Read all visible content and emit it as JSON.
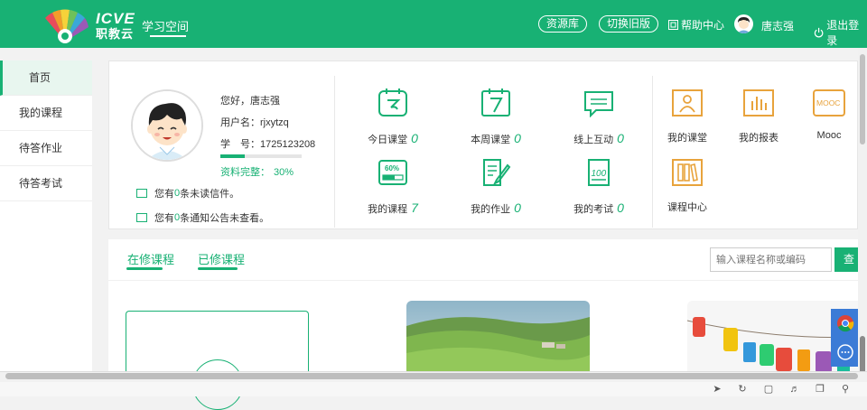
{
  "header": {
    "logo_en": "ICVE",
    "logo_cn": "职教云",
    "subtitle": "学习空间",
    "resource_btn": "资源库",
    "switch_btn": "切换旧版",
    "help": "帮助中心",
    "username": "唐志强",
    "logout": "退出登录"
  },
  "sidebar": {
    "items": [
      {
        "label": "首页",
        "active": true
      },
      {
        "label": "我的课程"
      },
      {
        "label": "待答作业"
      },
      {
        "label": "待答考试"
      }
    ]
  },
  "profile": {
    "greeting": "您好，唐志强",
    "username_line": "用户名：rjxytzq",
    "student_id_line": "学　号：1725123208",
    "completeness_label": "资料完整：",
    "completeness_value": "30%",
    "completeness": 0.3,
    "mail_pre": "您有",
    "mail_count": "0",
    "mail_post": "条未读信件。",
    "notice_pre": "您有",
    "notice_count": "0",
    "notice_post": "条通知公告未查看。"
  },
  "stats": [
    {
      "label": "今日课堂",
      "value": "0",
      "icon": "clock-bubble-icon"
    },
    {
      "label": "本周课堂",
      "value": "0",
      "icon": "calendar-7-icon"
    },
    {
      "label": "线上互动",
      "value": "0",
      "icon": "chat-icon"
    },
    {
      "label": "我的课程",
      "value": "7",
      "icon": "progress-60-icon",
      "icon_text": "60%"
    },
    {
      "label": "我的作业",
      "value": "0",
      "icon": "edit-doc-icon"
    },
    {
      "label": "我的考试",
      "value": "0",
      "icon": "exam-100-icon",
      "icon_text": "100"
    }
  ],
  "entries": [
    {
      "label": "我的课堂",
      "icon": "teacher-icon"
    },
    {
      "label": "我的报表",
      "icon": "bar-report-icon"
    },
    {
      "label": "Mooc",
      "icon": "mooc-icon",
      "icon_text": "MOOC"
    },
    {
      "label": "课程中心",
      "icon": "books-icon"
    }
  ],
  "courses": {
    "tab_active": "在修课程",
    "tab_done": "已修课程",
    "search_placeholder": "输入课程名称或编码",
    "search_btn": "查询"
  },
  "colors": {
    "brand": "#18b174",
    "entry_orange": "#e8a33c",
    "float_blue": "#3b7bd6"
  }
}
